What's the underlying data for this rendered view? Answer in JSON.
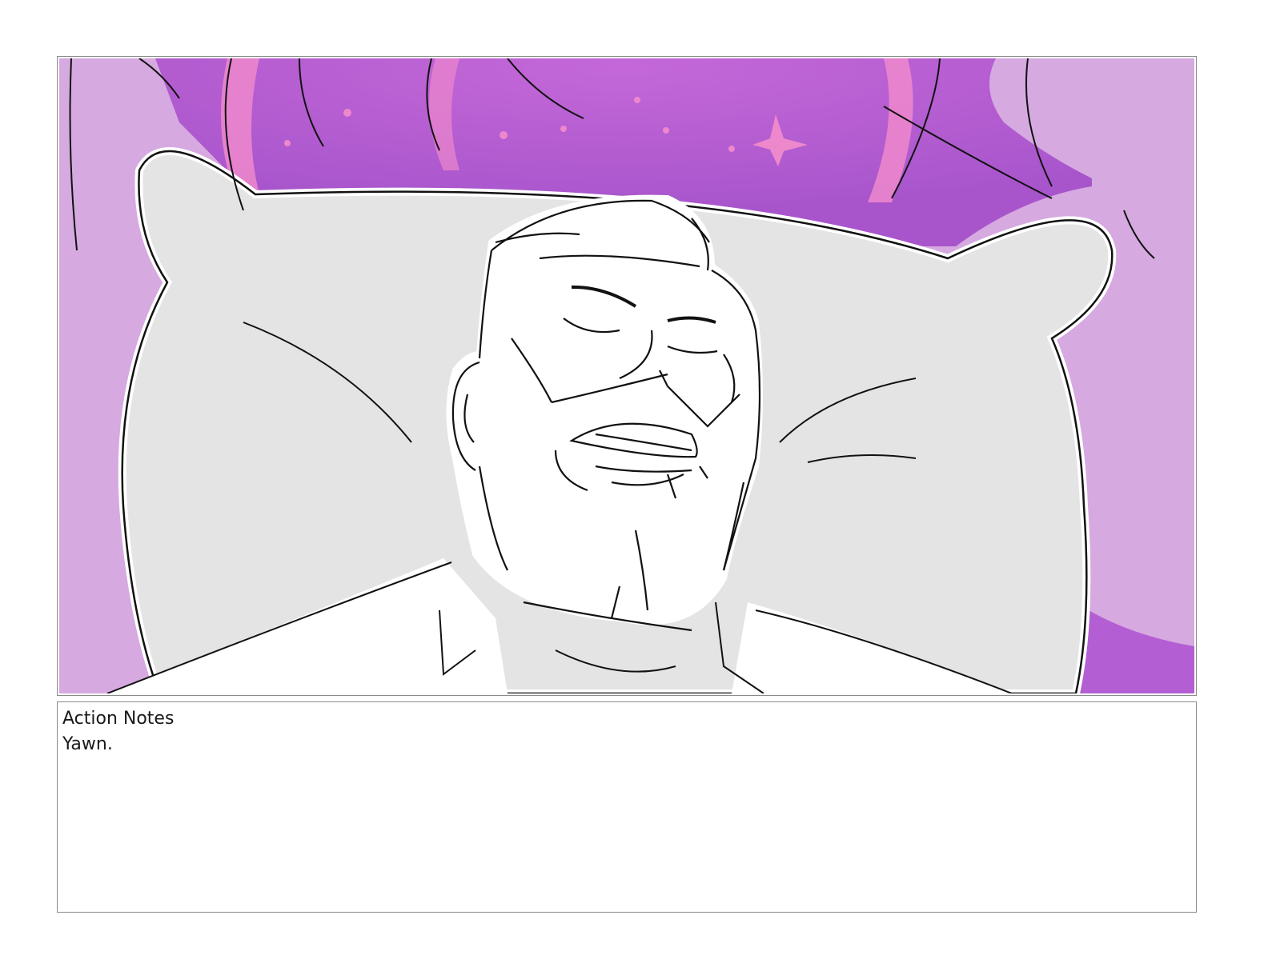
{
  "panel": {
    "image_icon": "storyboard-sketch",
    "colors": {
      "background_light": "#d6a9e0",
      "background_mid": "#b35fd3",
      "background_pink": "#ee88cc",
      "pillow": "#e4e4e4",
      "line": "#111111"
    }
  },
  "notes": {
    "heading": "Action Notes",
    "text": "Yawn."
  }
}
